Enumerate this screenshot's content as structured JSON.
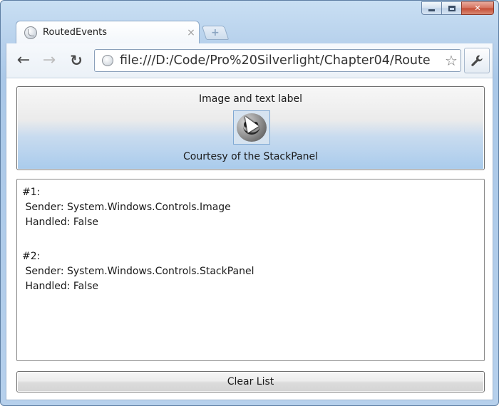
{
  "browser": {
    "tab_title": "RoutedEvents",
    "tab_close": "×",
    "new_tab_glyph": "+",
    "url": "file:///D:/Code/Pro%20Silverlight/Chapter04/Route",
    "back_glyph": "←",
    "forward_glyph": "→",
    "reload_glyph": "C",
    "star_glyph": "☆",
    "wrench_glyph": "🔧",
    "window_controls": {
      "close_glyph": "✕"
    }
  },
  "app": {
    "button": {
      "label_top": "Image and text label",
      "label_bottom": "Courtesy of the StackPanel",
      "image_icon": "smiley-face-icon"
    },
    "event_list": [
      {
        "header": "#1:",
        "sender": " Sender: System.Windows.Controls.Image",
        "handled": " Handled: False"
      },
      {
        "header": "#2:",
        "sender": " Sender: System.Windows.Controls.StackPanel",
        "handled": " Handled: False"
      }
    ],
    "clear_button_label": "Clear List"
  },
  "colors": {
    "window_frame": "#b7d1ec",
    "button_gradient_bottom": "#a9cbec",
    "close_button": "#c44b34"
  }
}
